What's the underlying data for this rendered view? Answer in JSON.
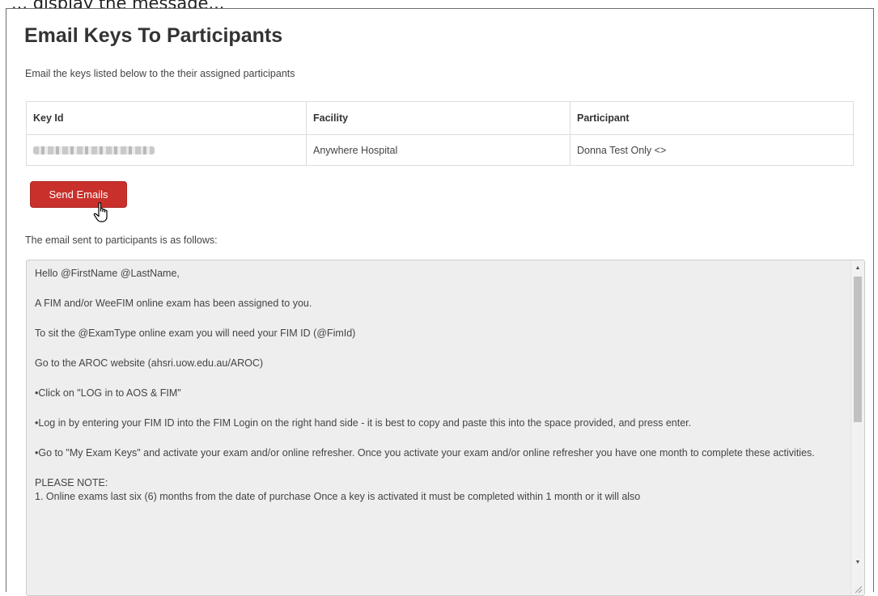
{
  "caption": "... display the message...",
  "page": {
    "title": "Email Keys To Participants",
    "subtitle": "Email the keys listed below to the their assigned participants"
  },
  "table": {
    "headers": [
      "Key Id",
      "Facility",
      "Participant"
    ],
    "rows": [
      {
        "key_id": "(blurred key)",
        "facility": "Anywhere Hospital",
        "participant": "Donna Test Only <>"
      }
    ]
  },
  "send_button_label": "Send Emails",
  "email_label": "The email sent to participants is as follows:",
  "email_body": {
    "line1": "Hello @FirstName @LastName,",
    "line2": "A FIM and/or WeeFIM online exam has been assigned to you.",
    "line3": "To sit the @ExamType online exam you will need your FIM ID (@FimId)",
    "line4": "Go to the AROC website (ahsri.uow.edu.au/AROC)",
    "line5": "•Click on \"LOG in to AOS & FIM\"",
    "line6": "•Log in by entering your FIM ID into the FIM Login on the right hand side - it is best to copy and paste this into the space provided, and press enter.",
    "line7": "•Go to \"My Exam Keys\" and activate your exam and/or online refresher.  Once you activate your exam and/or online refresher you have one month to complete these activities.",
    "line8": "PLEASE NOTE:",
    "line9": "1. Online exams last six (6) months from the date of purchase Once a key is activated it must be completed within 1 month or it will also"
  },
  "colors": {
    "send_button": "#c9302c",
    "email_box_bg": "#eeeeee"
  },
  "icons": [
    "hand-cursor-icon",
    "scroll-up-arrow-icon",
    "scroll-down-arrow-icon",
    "resize-grip-icon"
  ]
}
